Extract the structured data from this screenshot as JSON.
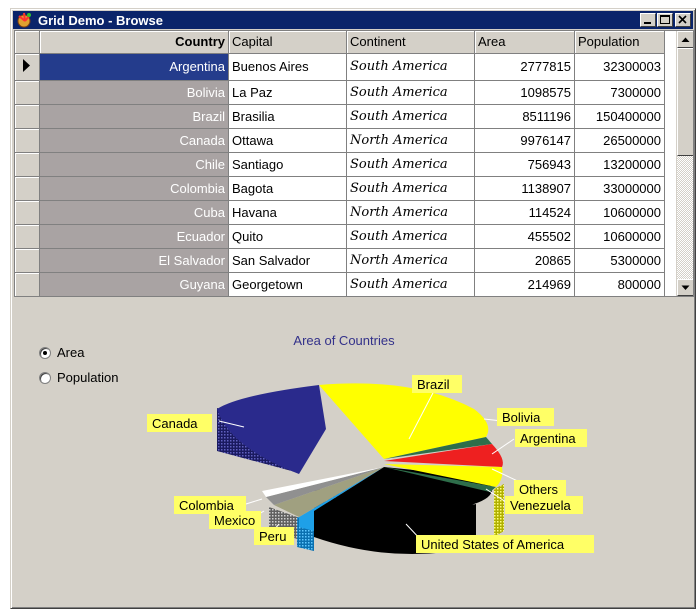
{
  "window": {
    "title": "Grid Demo - Browse"
  },
  "grid": {
    "columns": [
      "Country",
      "Capital",
      "Continent",
      "Area",
      "Population"
    ],
    "rows": [
      [
        "Argentina",
        "Buenos Aires",
        "South America",
        "2777815",
        "32300003"
      ],
      [
        "Bolivia",
        "La Paz",
        "South America",
        "1098575",
        "7300000"
      ],
      [
        "Brazil",
        "Brasilia",
        "South America",
        "8511196",
        "150400000"
      ],
      [
        "Canada",
        "Ottawa",
        "North America",
        "9976147",
        "26500000"
      ],
      [
        "Chile",
        "Santiago",
        "South America",
        "756943",
        "13200000"
      ],
      [
        "Colombia",
        "Bagota",
        "South America",
        "1138907",
        "33000000"
      ],
      [
        "Cuba",
        "Havana",
        "North America",
        "114524",
        "10600000"
      ],
      [
        "Ecuador",
        "Quito",
        "South America",
        "455502",
        "10600000"
      ],
      [
        "El Salvador",
        "San Salvador",
        "North America",
        "20865",
        "5300000"
      ],
      [
        "Guyana",
        "Georgetown",
        "South America",
        "214969",
        "800000"
      ]
    ],
    "current_row": 0
  },
  "options": {
    "area_label": "Area",
    "population_label": "Population",
    "selected": "Area"
  },
  "chart": {
    "title": "Area of Countries",
    "labels": {
      "brazil": "Brazil",
      "bolivia": "Bolivia",
      "argentina": "Argentina",
      "others": "Others",
      "venezuela": "Venezuela",
      "usa": "United States of America",
      "peru": "Peru",
      "mexico": "Mexico",
      "colombia": "Colombia",
      "canada": "Canada"
    },
    "colors": {
      "canada": "#2a2a8c",
      "brazil": "#ffff00",
      "bolivia": "#2e6e4a",
      "argentina": "#ee2020",
      "others": "#ffff00",
      "venezuela": "#2e6e4a",
      "usa": "#000000",
      "peru": "#1ea0e8",
      "mexico": "#a0a080",
      "colombia": "#909090"
    }
  }
}
